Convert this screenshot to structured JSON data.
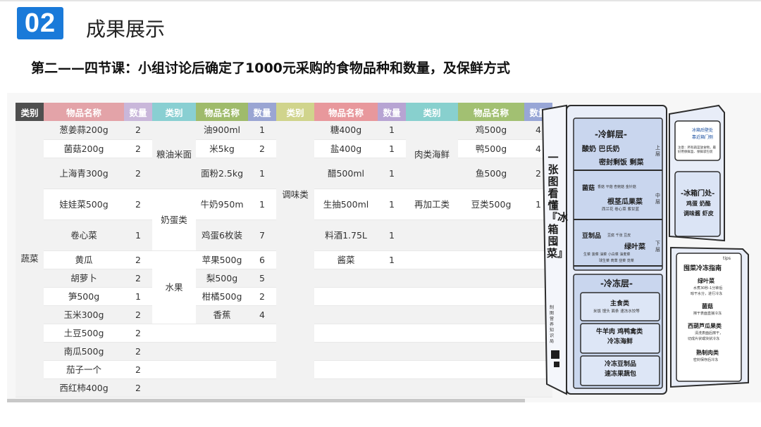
{
  "header": {
    "number": "02",
    "title": "成果展示"
  },
  "subtitle": "第二——四节课：小组讨论后确定了1000元采购的食物品种和数量，及保鲜方式",
  "table": {
    "headers": [
      "类别",
      "物品名称",
      "数量",
      "类别",
      "物品名称",
      "数量",
      "类别",
      "物品名称",
      "数量",
      "类别",
      "物品名称",
      "数量"
    ],
    "group_labels": {
      "vegetables": "蔬菜",
      "grain_oil": "粮油米面",
      "milk_eggs": "奶蛋类",
      "fruit": "水果",
      "seasoning": "调味类",
      "meat_seafood": "肉类海鲜",
      "processed": "再加工类"
    },
    "vegetables": [
      {
        "name": "葱姜蒜200g",
        "qty": "2"
      },
      {
        "name": "菌菇200g",
        "qty": "2"
      },
      {
        "name": "上海青300g",
        "qty": "2"
      },
      {
        "name": "娃娃菜500g",
        "qty": "2"
      },
      {
        "name": "卷心菜",
        "qty": "1"
      },
      {
        "name": "黄瓜",
        "qty": "2"
      },
      {
        "name": "胡萝卜",
        "qty": "2"
      },
      {
        "name": "笋500g",
        "qty": "1"
      },
      {
        "name": "玉米300g",
        "qty": "2"
      },
      {
        "name": "土豆500g",
        "qty": "2"
      },
      {
        "name": "南瓜500g",
        "qty": "2"
      },
      {
        "name": "茄子一个",
        "qty": "2"
      },
      {
        "name": "西红柿400g",
        "qty": "2"
      }
    ],
    "col2": [
      {
        "name": "油900ml",
        "qty": "1"
      },
      {
        "name": "米5kg",
        "qty": "2"
      },
      {
        "name": "面粉2.5kg",
        "qty": "1"
      },
      {
        "name": "牛奶950m",
        "qty": "1"
      },
      {
        "name": "鸡蛋6枚装",
        "qty": "7"
      },
      {
        "name": "苹果500g",
        "qty": "6"
      },
      {
        "name": "梨500g",
        "qty": "5"
      },
      {
        "name": "柑橘500g",
        "qty": "2"
      },
      {
        "name": "香蕉",
        "qty": "4"
      }
    ],
    "col3": [
      {
        "name": "糖400g",
        "qty": "1"
      },
      {
        "name": "盐400g",
        "qty": "1"
      },
      {
        "name": "醋500ml",
        "qty": "1"
      },
      {
        "name": "生抽500ml",
        "qty": "1"
      },
      {
        "name": "料酒1.75L",
        "qty": "1"
      },
      {
        "name": "酱菜",
        "qty": "1"
      }
    ],
    "col4": [
      {
        "name": "鸡500g",
        "qty": "4"
      },
      {
        "name": "鸭500g",
        "qty": "4"
      },
      {
        "name": "鱼500g",
        "qty": "2"
      },
      {
        "name": "豆类500g",
        "qty": "1"
      }
    ]
  },
  "fridge": {
    "side_title": "一张图看懂『冰箱囤菜』",
    "side_credit": "制图 营养知识局",
    "fresh_layer": "-冷鲜层-",
    "fresh_top": "酸奶 巴氏奶",
    "fresh_top2": "密封剩饭 剩菜",
    "fresh_top_tag": "上层",
    "mid_left": "菌菇",
    "mid_left_sub": "香菇 平菇 杏鲍菇 金针菇",
    "mid_main": "根茎瓜果菜",
    "mid_main_sub": "西兰花 卷心菜 紫甘蓝",
    "mid_tag": "中层",
    "low_left": "豆制品",
    "low_left_sub": "豆腐 千张 豆皮",
    "low_main": "绿叶菜",
    "low_main_sub": "生菜 菠菜 油菜 小白菜 油麦菜",
    "low_main_sub2": "球生菜 茼蒿 韭菜 苋菜",
    "low_tag": "下层",
    "freeze_layer": "-冷冻层-",
    "freeze1": "主食类",
    "freeze1_sub": "米饭 馒头 面条 速冻水饺等",
    "freeze2": "牛羊肉 鸡鸭禽类",
    "freeze2b": "冷冻海鲜",
    "freeze3": "冷冻豆制品",
    "freeze3b": "速冻果蔬包",
    "door_note1": "冰箱后壁处",
    "door_note2": "靠近箱门侧",
    "door_tip": "注意：所有蔬菜放食物，最好用保鲜盒、保鲜袋包装",
    "door_title": "-冰箱门处-",
    "door_items": "鸡蛋 奶酪",
    "door_items2": "调味酱 虾皮",
    "guide_tips": "tips",
    "guide_title": "囤菜冷冻指南",
    "guide_1": "绿叶菜",
    "guide_1_sub": "水煮30秒-1分钟后",
    "guide_1_sub2": "晾干水分，进行冷冻",
    "guide_2": "菌菇",
    "guide_2_sub": "擦干表面直接冷冻",
    "guide_3": "西葫芦瓜果类",
    "guide_3_sub": "清洗表面后擦干，",
    "guide_3_sub2": "切成片状或块状冷冻",
    "guide_4": "熟制肉类",
    "guide_4_sub": "密封保存后冷冻"
  }
}
